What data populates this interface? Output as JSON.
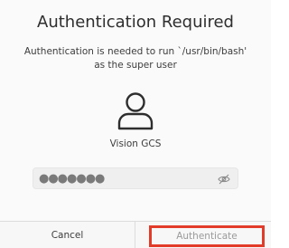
{
  "dialog": {
    "title": "Authentication Required",
    "message_line1": "Authentication is needed to run `/usr/bin/bash'",
    "message_line2": "as the super user",
    "user_name": "Vision GCS",
    "password_mask": "●●●●●●●",
    "icons": {
      "avatar": "user-avatar-icon",
      "reveal": "eye-slash-icon"
    },
    "buttons": {
      "cancel_label": "Cancel",
      "authenticate_label": "Authenticate"
    },
    "colors": {
      "highlight_border": "#e23b2a",
      "disabled_text": "#9a9a9a"
    }
  }
}
